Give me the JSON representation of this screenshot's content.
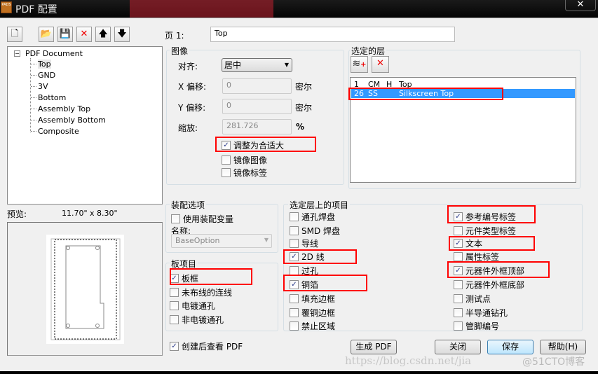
{
  "window": {
    "title": "PDF 配置",
    "app_badge": "PADS",
    "close": "✕"
  },
  "toolbar": {
    "new": "🗋",
    "open": "📂",
    "save": "💾",
    "delete": "✕",
    "up": "🡅",
    "down": "🡇"
  },
  "tree": {
    "root": "PDF Document",
    "items": [
      "Top",
      "GND",
      "3V",
      "Bottom",
      "Assembly Top",
      "Assembly Bottom",
      "Composite"
    ],
    "selected": "Top"
  },
  "page": {
    "label": "页 1:",
    "value": "Top"
  },
  "image": {
    "title": "图像",
    "align_label": "对齐:",
    "align_value": "居中",
    "x_label": "X 偏移:",
    "x_value": "0",
    "x_unit": "密尔",
    "y_label": "Y 偏移:",
    "y_value": "0",
    "y_unit": "密尔",
    "scale_label": "缩放:",
    "scale_value": "281.726",
    "scale_unit": "%",
    "options": [
      {
        "label": "调整为合适大",
        "checked": true
      },
      {
        "label": "镜像图像",
        "checked": false
      },
      {
        "label": "镜像标签",
        "checked": false
      }
    ]
  },
  "layers": {
    "title": "选定的层",
    "rows": [
      {
        "num": "1",
        "code": "CM",
        "flag": "H",
        "name": "Top",
        "selected": false
      },
      {
        "num": "26",
        "code": "SS",
        "flag": "",
        "name": "Silkscreen Top",
        "selected": true
      }
    ]
  },
  "preview": {
    "label": "预览:",
    "size": "11.70\" x  8.30\""
  },
  "assembly": {
    "title": "装配选项",
    "use_variant": {
      "label": "使用装配变量",
      "checked": false
    },
    "name_label": "名称:",
    "name_value": "BaseOption"
  },
  "board": {
    "title": "板项目",
    "items": [
      {
        "label": "板框",
        "checked": true
      },
      {
        "label": "未布线的连线",
        "checked": false
      },
      {
        "label": "电镀通孔",
        "checked": false
      },
      {
        "label": "非电镀通孔",
        "checked": false
      }
    ]
  },
  "view_after": {
    "label": "创建后查看 PDF",
    "checked": true
  },
  "layer_items": {
    "title": "选定层上的项目",
    "left": [
      {
        "label": "通孔焊盘",
        "checked": false
      },
      {
        "label": "SMD 焊盘",
        "checked": false
      },
      {
        "label": "导线",
        "checked": false
      },
      {
        "label": "2D 线",
        "checked": true
      },
      {
        "label": "过孔",
        "checked": false
      },
      {
        "label": "铜箔",
        "checked": true
      },
      {
        "label": "填充边框",
        "checked": false
      },
      {
        "label": "覆铜边框",
        "checked": false
      },
      {
        "label": "禁止区域",
        "checked": false
      }
    ],
    "right": [
      {
        "label": "参考编号标签",
        "checked": true
      },
      {
        "label": "元件类型标签",
        "checked": false
      },
      {
        "label": "文本",
        "checked": true
      },
      {
        "label": "属性标签",
        "checked": false
      },
      {
        "label": "元器件外框顶部",
        "checked": true
      },
      {
        "label": "元器件外框底部",
        "checked": false
      },
      {
        "label": "测试点",
        "checked": false
      },
      {
        "label": "半导通钻孔",
        "checked": false
      },
      {
        "label": "管脚编号",
        "checked": false
      }
    ]
  },
  "buttons": {
    "generate": "生成 PDF",
    "close": "关闭",
    "save": "保存",
    "help": "帮助(H)"
  },
  "watermark": {
    "url": "https://blog.csdn.net/jia",
    "brand": "@51CTO博客"
  },
  "colors": {
    "selection": "#3399ff",
    "highlight_box": "#ff0000"
  }
}
